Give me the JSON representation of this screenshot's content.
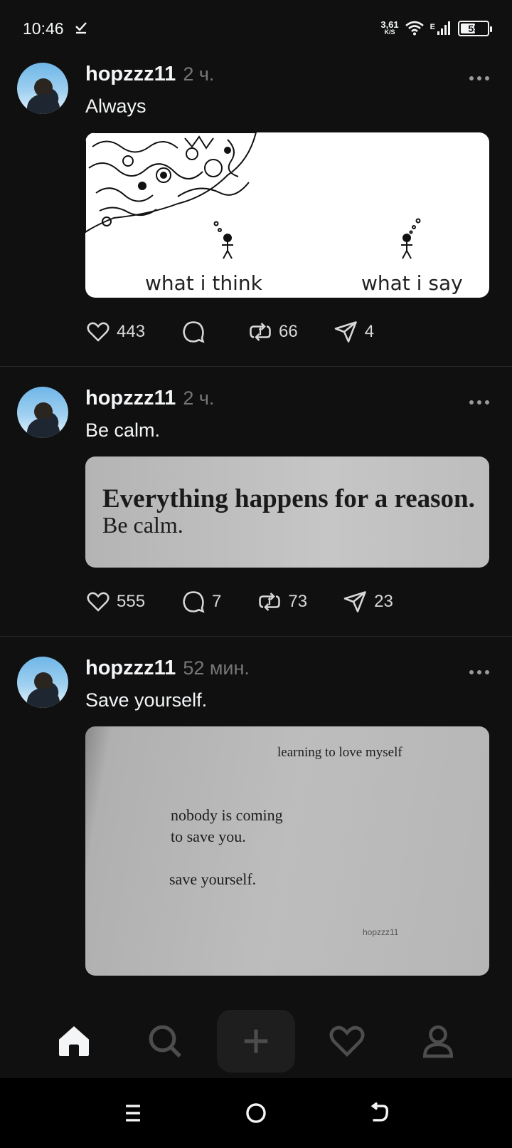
{
  "status_bar": {
    "time": "10:46",
    "net_speed_value": "3,61",
    "net_speed_unit": "K/S",
    "network_type": "E",
    "battery": "55",
    "battery_level": 0.55
  },
  "posts": [
    {
      "username": "hopzzz11",
      "time": "2 ч.",
      "text": "Always",
      "image": {
        "caption_left": "what i think",
        "caption_right": "what i say"
      },
      "likes": "443",
      "replies": "",
      "reposts": "66",
      "shares": "4"
    },
    {
      "username": "hopzzz11",
      "time": "2 ч.",
      "text": "Be calm.",
      "image": {
        "line1": "Everything happens for a reason.",
        "line2": "Be calm."
      },
      "likes": "555",
      "replies": "7",
      "reposts": "73",
      "shares": "23"
    },
    {
      "username": "hopzzz11",
      "time": "52 мин.",
      "text": "Save yourself.",
      "image": {
        "header": "learning to love myself",
        "line1": "nobody is coming",
        "line2": "to save you.",
        "line3": "save yourself.",
        "signature": "hopzzz11"
      }
    }
  ],
  "bottom_nav": {
    "items": [
      "home-icon",
      "search-icon",
      "plus-icon",
      "heart-icon",
      "profile-icon"
    ]
  },
  "system_nav": {
    "items": [
      "menu-icon",
      "home-circle-icon",
      "back-icon"
    ]
  }
}
